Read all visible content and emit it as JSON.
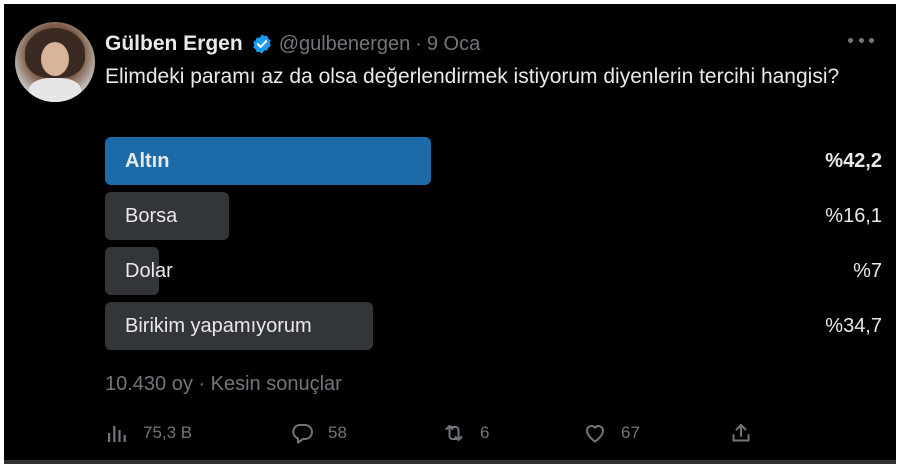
{
  "tweet": {
    "author_name": "Gülben Ergen",
    "handle": "@gulbenergen",
    "separator": "·",
    "date": "9 Oca",
    "text": "Elimdeki paramı az da olsa değerlendirmek istiyorum diyenlerin tercihi hangisi?"
  },
  "poll": {
    "options": [
      {
        "label": "Altın",
        "percent_text": "%42,2",
        "share": 0.422,
        "winner": true
      },
      {
        "label": "Borsa",
        "percent_text": "%16,1",
        "share": 0.161,
        "winner": false
      },
      {
        "label": "Dolar",
        "percent_text": "%7",
        "share": 0.07,
        "winner": false
      },
      {
        "label": "Birikim yapamıyorum",
        "percent_text": "%34,7",
        "share": 0.347,
        "winner": false
      }
    ],
    "summary": "10.430 oy · Kesin sonuçlar"
  },
  "actions": {
    "views": "75,3 B",
    "replies": "58",
    "retweets": "6",
    "likes": "67"
  },
  "colors": {
    "background": "#000000",
    "winner_bar": "#1d6aa8",
    "bar": "#333639",
    "verified": "#1d9bf0",
    "muted": "#71767b"
  },
  "icons": [
    "verified-badge-icon",
    "more-icon",
    "views-icon",
    "reply-icon",
    "retweet-icon",
    "like-icon",
    "share-icon"
  ]
}
